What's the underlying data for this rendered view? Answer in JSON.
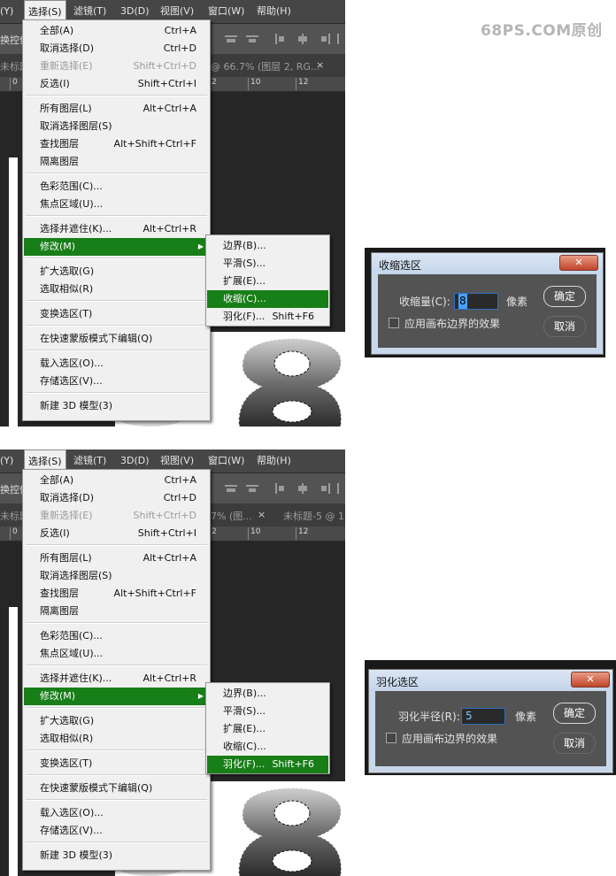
{
  "watermark": "68PS.COM原创",
  "menubar": {
    "items": [
      "(Y)",
      "选择(S)",
      "滤镜(T)",
      "3D(D)",
      "视图(V)",
      "窗口(W)",
      "帮助(H)"
    ]
  },
  "options_bar": {
    "left_text": "换控件"
  },
  "panel1": {
    "tabs": [
      "未标题",
      "@ 66.7% (图层 2, RG...",
      "×"
    ],
    "ruler": [
      "0",
      "2",
      "10",
      "12"
    ]
  },
  "panel2": {
    "tabs": [
      "未标题",
      "7% (图...",
      "×",
      "未标题-5 @ 1("
    ],
    "ruler": [
      "0",
      "2",
      "10",
      "12"
    ]
  },
  "select_menu": {
    "groups": [
      [
        {
          "label": "全部(A)",
          "shortcut": "Ctrl+A"
        },
        {
          "label": "取消选择(D)",
          "shortcut": "Ctrl+D"
        },
        {
          "label": "重新选择(E)",
          "shortcut": "Shift+Ctrl+D",
          "disabled": true
        },
        {
          "label": "反选(I)",
          "shortcut": "Shift+Ctrl+I"
        }
      ],
      [
        {
          "label": "所有图层(L)",
          "shortcut": "Alt+Ctrl+A"
        },
        {
          "label": "取消选择图层(S)",
          "shortcut": ""
        },
        {
          "label": "查找图层",
          "shortcut": "Alt+Shift+Ctrl+F"
        },
        {
          "label": "隔离图层",
          "shortcut": ""
        }
      ],
      [
        {
          "label": "色彩范围(C)...",
          "shortcut": ""
        },
        {
          "label": "焦点区域(U)...",
          "shortcut": ""
        }
      ],
      [
        {
          "label": "选择并遮住(K)...",
          "shortcut": "Alt+Ctrl+R"
        },
        {
          "label": "修改(M)",
          "shortcut": "",
          "submenu": true,
          "highlighted": true
        }
      ],
      [
        {
          "label": "扩大选取(G)",
          "shortcut": ""
        },
        {
          "label": "选取相似(R)",
          "shortcut": ""
        }
      ],
      [
        {
          "label": "变换选区(T)",
          "shortcut": ""
        }
      ],
      [
        {
          "label": "在快速蒙版模式下编辑(Q)",
          "shortcut": ""
        }
      ],
      [
        {
          "label": "载入选区(O)...",
          "shortcut": ""
        },
        {
          "label": "存储选区(V)...",
          "shortcut": ""
        }
      ],
      [
        {
          "label": "新建 3D 模型(3)",
          "shortcut": ""
        }
      ]
    ]
  },
  "modify_submenu": {
    "items": [
      {
        "label": "边界(B)...",
        "shortcut": ""
      },
      {
        "label": "平滑(S)...",
        "shortcut": ""
      },
      {
        "label": "扩展(E)...",
        "shortcut": ""
      },
      {
        "label": "收缩(C)...",
        "shortcut": ""
      },
      {
        "label": "羽化(F)...",
        "shortcut": "Shift+F6"
      }
    ],
    "highlighted_panel1": 3,
    "highlighted_panel2": 4
  },
  "dialog_contract": {
    "title": "收缩选区",
    "field_label": "收缩量(C):",
    "value": "8",
    "unit": "像素",
    "checkbox_label": "应用画布边界的效果",
    "ok": "确定",
    "cancel": "取消",
    "close": "✕"
  },
  "dialog_feather": {
    "title": "羽化选区",
    "field_label": "羽化半径(R):",
    "value": "5",
    "unit": "像素",
    "checkbox_label": "应用画布边界的效果",
    "ok": "确定",
    "cancel": "取消",
    "close": "✕"
  },
  "colors": {
    "highlight": "#187e18",
    "menu_bg": "#f0f0f0",
    "app_dark": "#383838",
    "dialog_body": "#535353"
  }
}
